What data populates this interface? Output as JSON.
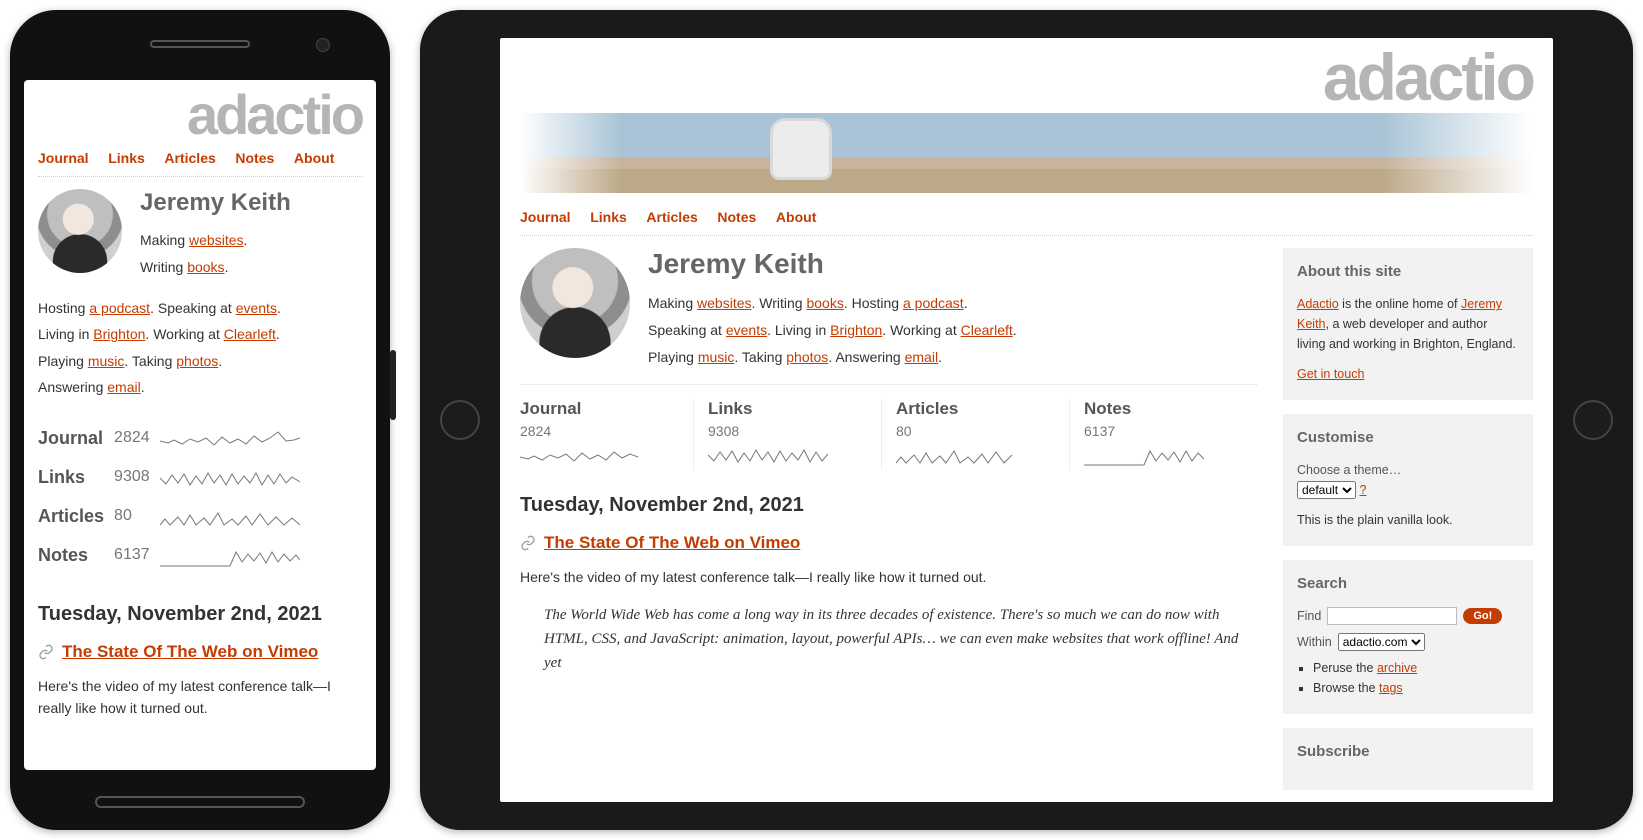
{
  "brand": "adactio",
  "nav": {
    "journal": "Journal",
    "links": "Links",
    "articles": "Articles",
    "notes": "Notes",
    "about": "About"
  },
  "author": {
    "name": "Jeremy Keith",
    "bio": {
      "making": "Making ",
      "websites": "websites",
      "dot1": ". ",
      "writing": "Writing ",
      "books": "books",
      "dot2": ". ",
      "hosting": "Hosting ",
      "podcast": "a podcast",
      "dot3": ". ",
      "speaking": "Speaking at ",
      "events": "events",
      "dot4": ". ",
      "living": "Living in ",
      "brighton": "Brighton",
      "dot5": ". ",
      "working": "Working at ",
      "clearleft": "Clearleft",
      "dot6": ". ",
      "playing": "Playing ",
      "music": "music",
      "dot7": ". ",
      "taking": "Taking ",
      "photos": "photos",
      "dot8": ". ",
      "answering": "Answering ",
      "email": "email",
      "dot9": "."
    }
  },
  "stats": {
    "journal": {
      "label": "Journal",
      "count": "2824"
    },
    "links": {
      "label": "Links",
      "count": "9308"
    },
    "articles": {
      "label": "Articles",
      "count": "80"
    },
    "notes": {
      "label": "Notes",
      "count": "6137"
    }
  },
  "post": {
    "date": "Tuesday, November 2nd, 2021",
    "title": "The State Of The Web on Vimeo",
    "excerpt": "Here's the video of my latest conference talk—I really like how it turned out.",
    "quote": "The World Wide Web has come a long way in its three decades of existence. There's so much we can do now with HTML, CSS, and JavaScript: animation, layout, powerful APIs… we can even make websites that work offline! And yet"
  },
  "sidebar": {
    "about": {
      "heading": "About this site",
      "t1": "Adactio",
      "t2": " is the online home of ",
      "t3": "Jeremy Keith",
      "t4": ", a web developer and author living and working in Brighton, England.",
      "contact": "Get in touch"
    },
    "customise": {
      "heading": "Customise",
      "choose": "Choose a theme…",
      "selected": "default",
      "help": "?",
      "desc": "This is the plain vanilla look."
    },
    "search": {
      "heading": "Search",
      "find": "Find",
      "go": "Go!",
      "within": "Within",
      "within_selected": "adactio.com",
      "peruse": "Peruse the ",
      "archive": "archive",
      "browse": "Browse the ",
      "tags": "tags"
    },
    "subscribe": {
      "heading": "Subscribe"
    }
  }
}
